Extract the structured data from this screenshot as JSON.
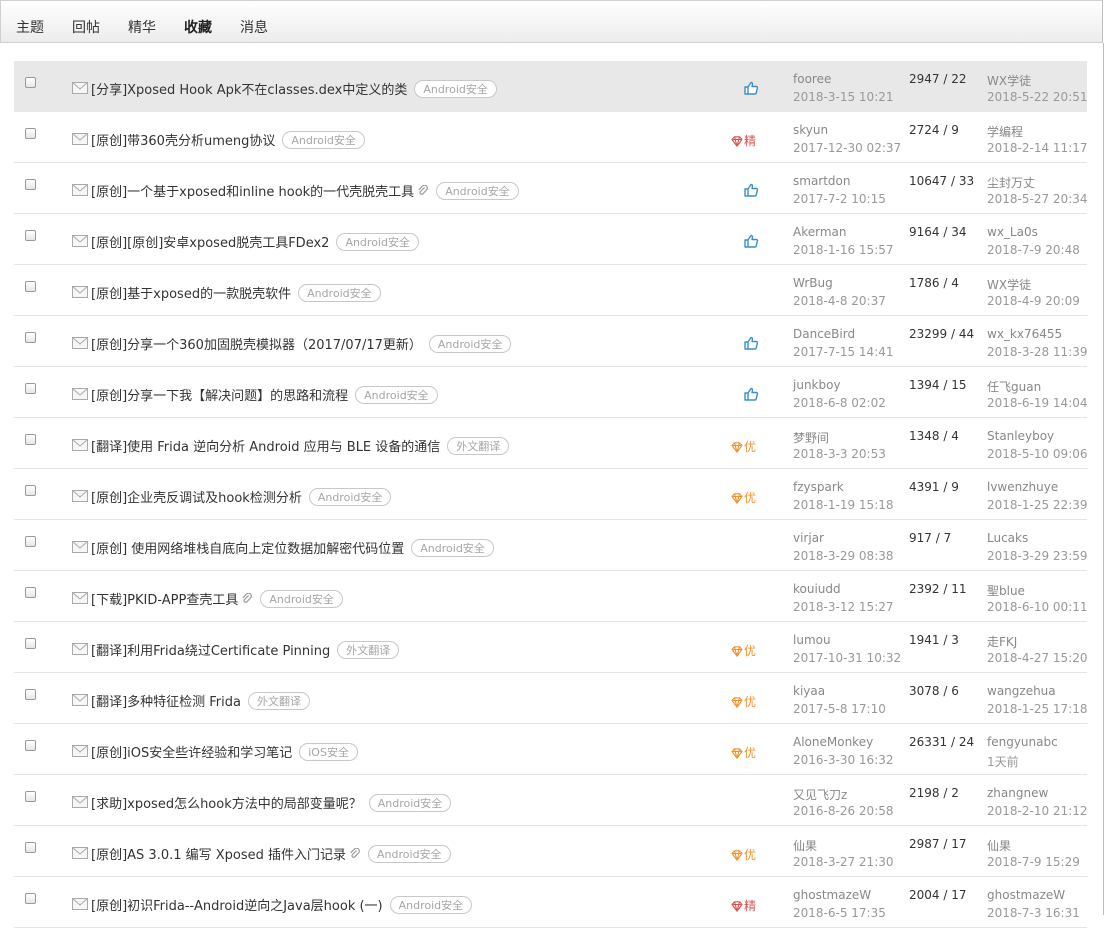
{
  "nav": {
    "tabs": [
      {
        "label": "主题"
      },
      {
        "label": "回帖"
      },
      {
        "label": "精华"
      },
      {
        "label": "收藏"
      },
      {
        "label": "消息"
      }
    ],
    "active_index": 3
  },
  "colors": {
    "jing": "#d9534f",
    "you": "#f0922e",
    "top": "#3a8fc9",
    "tag_border": "#c8c8c8"
  },
  "threads": [
    {
      "title": "[分享]Xposed Hook Apk不在classes.dex中定义的类",
      "attach": false,
      "tag": "Android安全",
      "badge": "top",
      "badge_text": "",
      "author": "fooree",
      "author_date": "2018-3-15 10:21",
      "stats": "2947 / 22",
      "replier": "WX学徒",
      "reply_date": "2018-5-22 20:51"
    },
    {
      "title": "[原创]带360壳分析umeng协议",
      "attach": false,
      "tag": "Android安全",
      "badge": "jing",
      "badge_text": "精",
      "author": "skyun",
      "author_date": "2017-12-30 02:37",
      "stats": "2724 / 9",
      "replier": "学编程",
      "reply_date": "2018-2-14 11:17"
    },
    {
      "title": "[原创]一个基于xposed和inline hook的一代壳脱壳工具",
      "attach": true,
      "tag": "Android安全",
      "badge": "top",
      "badge_text": "",
      "author": "smartdon",
      "author_date": "2017-7-2 10:15",
      "stats": "10647 / 33",
      "replier": "尘封万丈",
      "reply_date": "2018-5-27 20:34"
    },
    {
      "title": "[原创][原创]安卓xposed脱壳工具FDex2",
      "attach": false,
      "tag": "Android安全",
      "badge": "top",
      "badge_text": "",
      "author": "Akerman",
      "author_date": "2018-1-16 15:57",
      "stats": "9164 / 34",
      "replier": "wx_La0s",
      "reply_date": "2018-7-9 20:48"
    },
    {
      "title": "[原创]基于xposed的一款脱壳软件",
      "attach": false,
      "tag": "Android安全",
      "badge": "none",
      "badge_text": "",
      "author": "WrBug",
      "author_date": "2018-4-8 20:37",
      "stats": "1786 / 4",
      "replier": "WX学徒",
      "reply_date": "2018-4-9 20:09"
    },
    {
      "title": "[原创]分享一个360加固脱壳模拟器（2017/07/17更新）",
      "attach": false,
      "tag": "Android安全",
      "badge": "top",
      "badge_text": "",
      "author": "DanceBird",
      "author_date": "2017-7-15 14:41",
      "stats": "23299 / 44",
      "replier": "wx_kx76455",
      "reply_date": "2018-3-28 11:39"
    },
    {
      "title": "[原创]分享一下我【解决问题】的思路和流程",
      "attach": false,
      "tag": "Android安全",
      "badge": "top",
      "badge_text": "",
      "author": "junkboy",
      "author_date": "2018-6-8 02:02",
      "stats": "1394 / 15",
      "replier": "任飞guan",
      "reply_date": "2018-6-19 14:04"
    },
    {
      "title": "[翻译]使用 Frida 逆向分析 Android 应用与 BLE 设备的通信",
      "attach": false,
      "tag": "外文翻译",
      "badge": "you",
      "badge_text": "优",
      "author": "梦野间",
      "author_date": "2018-3-3 20:53",
      "stats": "1348 / 4",
      "replier": "Stanleyboy",
      "reply_date": "2018-5-10 09:06"
    },
    {
      "title": "[原创]企业壳反调试及hook检测分析",
      "attach": false,
      "tag": "Android安全",
      "badge": "you",
      "badge_text": "优",
      "author": "fzyspark",
      "author_date": "2018-1-19 15:18",
      "stats": "4391 / 9",
      "replier": "lvwenzhuye",
      "reply_date": "2018-1-25 22:39"
    },
    {
      "title": "[原创] 使用网络堆栈自底向上定位数据加解密代码位置",
      "attach": false,
      "tag": "Android安全",
      "badge": "none",
      "badge_text": "",
      "author": "virjar",
      "author_date": "2018-3-29 08:38",
      "stats": "917 / 7",
      "replier": "Lucaks",
      "reply_date": "2018-3-29 23:59"
    },
    {
      "title": "[下载]PKID-APP查壳工具",
      "attach": true,
      "tag": "Android安全",
      "badge": "none",
      "badge_text": "",
      "author": "kouiudd",
      "author_date": "2018-3-12 15:27",
      "stats": "2392 / 11",
      "replier": "聖blue",
      "reply_date": "2018-6-10 00:11"
    },
    {
      "title": "[翻译]利用Frida绕过Certificate Pinning",
      "attach": false,
      "tag": "外文翻译",
      "badge": "you",
      "badge_text": "优",
      "author": "lumou",
      "author_date": "2017-10-31 10:32",
      "stats": "1941 / 3",
      "replier": "走FKJ",
      "reply_date": "2018-4-27 15:20"
    },
    {
      "title": "[翻译]多种特征检测 Frida",
      "attach": false,
      "tag": "外文翻译",
      "badge": "you",
      "badge_text": "优",
      "author": "kiyaa",
      "author_date": "2017-5-8 17:10",
      "stats": "3078 / 6",
      "replier": "wangzehua",
      "reply_date": "2018-1-25 17:18"
    },
    {
      "title": "[原创]iOS安全些许经验和学习笔记",
      "attach": false,
      "tag": "iOS安全",
      "badge": "you",
      "badge_text": "优",
      "author": "AloneMonkey",
      "author_date": "2016-3-30 16:32",
      "stats": "26331 / 24",
      "replier": "fengyunabc",
      "reply_date": "1天前"
    },
    {
      "title": "[求助]xposed怎么hook方法中的局部变量呢？",
      "attach": false,
      "tag": "Android安全",
      "badge": "none",
      "badge_text": "",
      "author": "又见飞刀z",
      "author_date": "2016-8-26 20:58",
      "stats": "2198 / 2",
      "replier": "zhangnew",
      "reply_date": "2018-2-10 21:12"
    },
    {
      "title": "[原创]AS 3.0.1 编写 Xposed 插件入门记录",
      "attach": true,
      "tag": "Android安全",
      "badge": "you",
      "badge_text": "优",
      "author": "仙果",
      "author_date": "2018-3-27 21:30",
      "stats": "2987 / 17",
      "replier": "仙果",
      "reply_date": "2018-7-9 15:29"
    },
    {
      "title": "[原创]初识Frida--Android逆向之Java层hook (一)",
      "attach": false,
      "tag": "Android安全",
      "badge": "jing",
      "badge_text": "精",
      "author": "ghostmazeW",
      "author_date": "2018-6-5 17:35",
      "stats": "2004 / 17",
      "replier": "ghostmazeW",
      "reply_date": "2018-7-3 16:31"
    }
  ]
}
